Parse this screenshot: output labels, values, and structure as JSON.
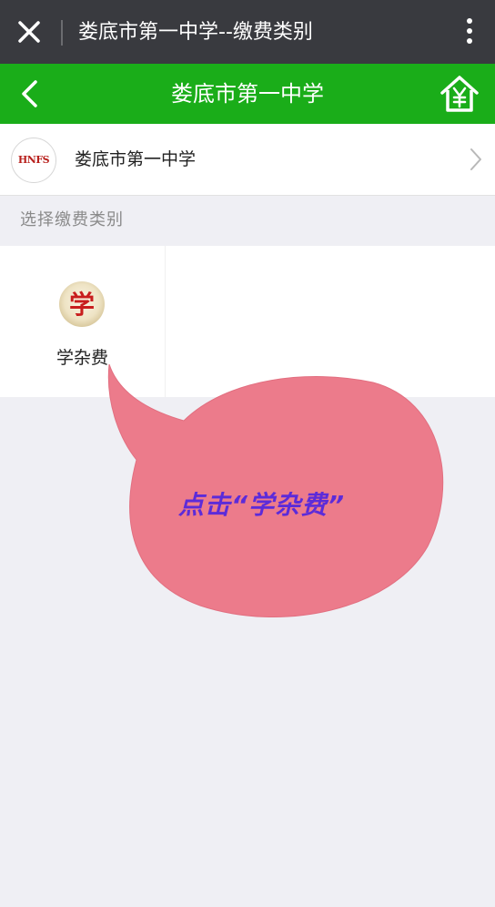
{
  "window": {
    "title": "娄底市第一中学--缴费类别",
    "close_icon": "close-icon",
    "more_icon": "more-vertical-icon"
  },
  "navbar": {
    "title": "娄底市第一中学",
    "back_icon": "chevron-left-icon",
    "home_icon": "home-yuan-icon",
    "color": "#1aad19"
  },
  "school": {
    "logo_text": "HNFS",
    "name": "娄底市第一中学",
    "chevron_icon": "chevron-right-icon"
  },
  "section": {
    "label": "选择缴费类别"
  },
  "categories": [
    {
      "label": "学杂费",
      "icon_glyph": "学",
      "icon": "xue-badge-icon"
    }
  ],
  "annotation": {
    "text": "点击“学杂费”",
    "bubble_color": "#ec7b8b",
    "text_color": "#5c2bd9"
  }
}
